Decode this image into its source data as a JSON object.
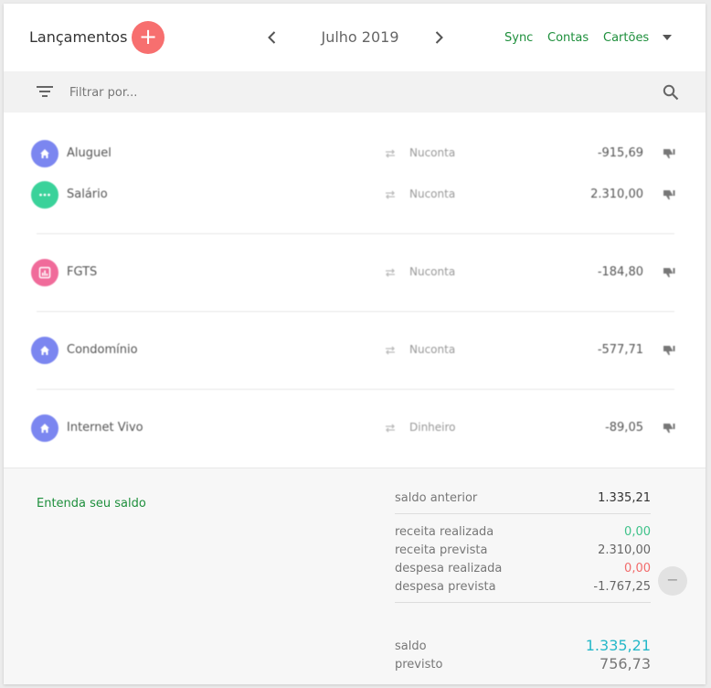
{
  "header": {
    "title": "Lançamentos",
    "add_label": "+",
    "month": "Julho 2019",
    "prev_label": "‹",
    "next_label": "›",
    "links": [
      "Sync",
      "Contas",
      "Cartões"
    ]
  },
  "filter": {
    "placeholder": "Filtrar por..."
  },
  "transactions": [
    {
      "name": "Aluguel",
      "account": "Nuconta",
      "value": "-915,69",
      "icon": "home-icon",
      "color": "#7b86f0"
    },
    {
      "name": "Salário",
      "account": "Nuconta",
      "value": "2.310,00",
      "icon": "more-icon",
      "color": "#3ad29a"
    },
    {
      "name": "FGTS",
      "account": "Nuconta",
      "value": "-184,80",
      "icon": "chart-icon",
      "color": "#f06b9a"
    },
    {
      "name": "Condomínio",
      "account": "Nuconta",
      "value": "-577,71",
      "icon": "home-icon",
      "color": "#7b86f0"
    },
    {
      "name": "Internet Vivo",
      "account": "Dinheiro",
      "value": "-89,05",
      "icon": "home-icon",
      "color": "#7b86f0"
    }
  ],
  "summary": {
    "entenda": "Entenda seu saldo",
    "saldo_anterior_label": "saldo anterior",
    "saldo_anterior": "1.335,21",
    "receita_realizada_label": "receita realizada",
    "receita_realizada": "0,00",
    "receita_prevista_label": "receita prevista",
    "receita_prevista": "2.310,00",
    "despesa_realizada_label": "despesa realizada",
    "despesa_realizada": "0,00",
    "despesa_prevista_label": "despesa prevista",
    "despesa_prevista": "-1.767,25",
    "saldo_label": "saldo",
    "saldo": "1.335,21",
    "previsto_label": "previsto",
    "previsto": "756,73",
    "minus_label": "−"
  },
  "colors": {
    "accent_green": "#1e8f3c",
    "add_button": "#f76f6f",
    "positive": "#3fc28a",
    "negative": "#f26b6b",
    "saldo": "#26b8c9"
  }
}
